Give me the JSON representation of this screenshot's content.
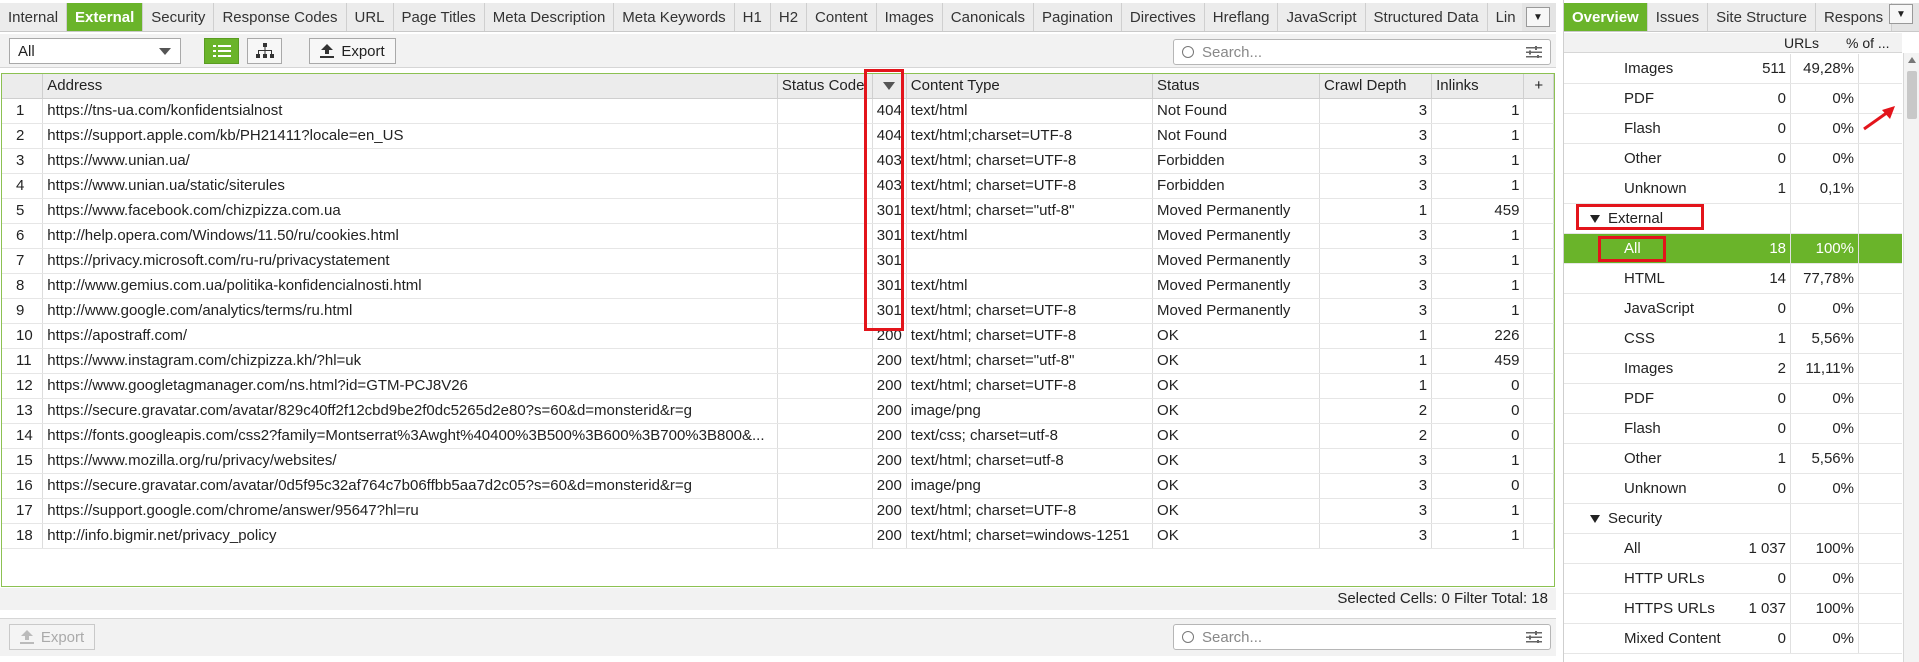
{
  "left_tabs": [
    "Internal",
    "External",
    "Security",
    "Response Codes",
    "URL",
    "Page Titles",
    "Meta Description",
    "Meta Keywords",
    "H1",
    "H2",
    "Content",
    "Images",
    "Canonicals",
    "Pagination",
    "Directives",
    "Hreflang",
    "JavaScript",
    "Structured Data",
    "Lin"
  ],
  "active_left_tab": "External",
  "toolbar": {
    "filter_value": "All",
    "export_label": "Export",
    "search_placeholder": "Search..."
  },
  "table": {
    "columns": [
      "Address",
      "Status Code",
      "",
      "Content Type",
      "Status",
      "Crawl Depth",
      "Inlinks"
    ],
    "rows": [
      {
        "n": "1",
        "address": "https://tns-ua.com/konfidentsialnost",
        "code": "404",
        "ctype": "text/html",
        "status": "Not Found",
        "depth": "3",
        "inlinks": "1"
      },
      {
        "n": "2",
        "address": "https://support.apple.com/kb/PH21411?locale=en_US",
        "code": "404",
        "ctype": "text/html;charset=UTF-8",
        "status": "Not Found",
        "depth": "3",
        "inlinks": "1"
      },
      {
        "n": "3",
        "address": "https://www.unian.ua/",
        "code": "403",
        "ctype": "text/html; charset=UTF-8",
        "status": "Forbidden",
        "depth": "3",
        "inlinks": "1"
      },
      {
        "n": "4",
        "address": "https://www.unian.ua/static/siterules",
        "code": "403",
        "ctype": "text/html; charset=UTF-8",
        "status": "Forbidden",
        "depth": "3",
        "inlinks": "1"
      },
      {
        "n": "5",
        "address": "https://www.facebook.com/chizpizza.com.ua",
        "code": "301",
        "ctype": "text/html; charset=\"utf-8\"",
        "status": "Moved Permanently",
        "depth": "1",
        "inlinks": "459"
      },
      {
        "n": "6",
        "address": "http://help.opera.com/Windows/11.50/ru/cookies.html",
        "code": "301",
        "ctype": "text/html",
        "status": "Moved Permanently",
        "depth": "3",
        "inlinks": "1"
      },
      {
        "n": "7",
        "address": "https://privacy.microsoft.com/ru-ru/privacystatement",
        "code": "301",
        "ctype": "",
        "status": "Moved Permanently",
        "depth": "3",
        "inlinks": "1"
      },
      {
        "n": "8",
        "address": "http://www.gemius.com.ua/politika-konfidencialnosti.html",
        "code": "301",
        "ctype": "text/html",
        "status": "Moved Permanently",
        "depth": "3",
        "inlinks": "1"
      },
      {
        "n": "9",
        "address": "http://www.google.com/analytics/terms/ru.html",
        "code": "301",
        "ctype": "text/html; charset=UTF-8",
        "status": "Moved Permanently",
        "depth": "3",
        "inlinks": "1"
      },
      {
        "n": "10",
        "address": "https://apostraff.com/",
        "code": "200",
        "ctype": "text/html; charset=UTF-8",
        "status": "OK",
        "depth": "1",
        "inlinks": "226"
      },
      {
        "n": "11",
        "address": "https://www.instagram.com/chizpizza.kh/?hl=uk",
        "code": "200",
        "ctype": "text/html; charset=\"utf-8\"",
        "status": "OK",
        "depth": "1",
        "inlinks": "459"
      },
      {
        "n": "12",
        "address": "https://www.googletagmanager.com/ns.html?id=GTM-PCJ8V26",
        "code": "200",
        "ctype": "text/html; charset=UTF-8",
        "status": "OK",
        "depth": "1",
        "inlinks": "0"
      },
      {
        "n": "13",
        "address": "https://secure.gravatar.com/avatar/829c40ff2f12cbd9be2f0dc5265d2e80?s=60&d=monsterid&r=g",
        "code": "200",
        "ctype": "image/png",
        "status": "OK",
        "depth": "2",
        "inlinks": "0"
      },
      {
        "n": "14",
        "address": "https://fonts.googleapis.com/css2?family=Montserrat%3Awght%40400%3B500%3B600%3B700%3B800&...",
        "code": "200",
        "ctype": "text/css; charset=utf-8",
        "status": "OK",
        "depth": "2",
        "inlinks": "0"
      },
      {
        "n": "15",
        "address": "https://www.mozilla.org/ru/privacy/websites/",
        "code": "200",
        "ctype": "text/html; charset=utf-8",
        "status": "OK",
        "depth": "3",
        "inlinks": "1"
      },
      {
        "n": "16",
        "address": "https://secure.gravatar.com/avatar/0d5f95c32af764c7b06ffbb5aa7d2c05?s=60&d=monsterid&r=g",
        "code": "200",
        "ctype": "image/png",
        "status": "OK",
        "depth": "3",
        "inlinks": "0"
      },
      {
        "n": "17",
        "address": "https://support.google.com/chrome/answer/95647?hl=ru",
        "code": "200",
        "ctype": "text/html; charset=UTF-8",
        "status": "OK",
        "depth": "3",
        "inlinks": "1"
      },
      {
        "n": "18",
        "address": "http://info.bigmir.net/privacy_policy",
        "code": "200",
        "ctype": "text/html; charset=windows-1251",
        "status": "OK",
        "depth": "3",
        "inlinks": "1"
      }
    ]
  },
  "statusbar": "Selected Cells:  0  Filter Total:  18",
  "bottom": {
    "export_label": "Export",
    "search_placeholder": "Search..."
  },
  "right_tabs": [
    "Overview",
    "Issues",
    "Site Structure",
    "Respons"
  ],
  "active_right_tab": "Overview",
  "right_header": {
    "urls": "URLs",
    "pct": "% of ..."
  },
  "right_rows": [
    {
      "label": "Images",
      "count": "511",
      "pct": "49,28%",
      "kind": "item"
    },
    {
      "label": "PDF",
      "count": "0",
      "pct": "0%",
      "kind": "item"
    },
    {
      "label": "Flash",
      "count": "0",
      "pct": "0%",
      "kind": "item"
    },
    {
      "label": "Other",
      "count": "0",
      "pct": "0%",
      "kind": "item"
    },
    {
      "label": "Unknown",
      "count": "1",
      "pct": "0,1%",
      "kind": "item"
    },
    {
      "label": "External",
      "count": "",
      "pct": "",
      "kind": "group"
    },
    {
      "label": "All",
      "count": "18",
      "pct": "100%",
      "kind": "selected"
    },
    {
      "label": "HTML",
      "count": "14",
      "pct": "77,78%",
      "kind": "item"
    },
    {
      "label": "JavaScript",
      "count": "0",
      "pct": "0%",
      "kind": "item"
    },
    {
      "label": "CSS",
      "count": "1",
      "pct": "5,56%",
      "kind": "item"
    },
    {
      "label": "Images",
      "count": "2",
      "pct": "11,11%",
      "kind": "item"
    },
    {
      "label": "PDF",
      "count": "0",
      "pct": "0%",
      "kind": "item"
    },
    {
      "label": "Flash",
      "count": "0",
      "pct": "0%",
      "kind": "item"
    },
    {
      "label": "Other",
      "count": "1",
      "pct": "5,56%",
      "kind": "item"
    },
    {
      "label": "Unknown",
      "count": "0",
      "pct": "0%",
      "kind": "item"
    },
    {
      "label": "Security",
      "count": "",
      "pct": "",
      "kind": "group"
    },
    {
      "label": "All",
      "count": "1 037",
      "pct": "100%",
      "kind": "item"
    },
    {
      "label": "HTTP URLs",
      "count": "0",
      "pct": "0%",
      "kind": "item"
    },
    {
      "label": "HTTPS URLs",
      "count": "1 037",
      "pct": "100%",
      "kind": "item"
    },
    {
      "label": "Mixed Content",
      "count": "0",
      "pct": "0%",
      "kind": "item"
    }
  ],
  "colors": {
    "accent": "#6ab42a",
    "highlight": "#e3141b"
  },
  "icons": [
    "list-view-icon",
    "tree-view-icon",
    "export-icon",
    "search-icon",
    "filter-settings-icon",
    "dropdown-caret-icon",
    "sort-desc-icon",
    "add-column-icon",
    "expand-triangle-icon"
  ]
}
